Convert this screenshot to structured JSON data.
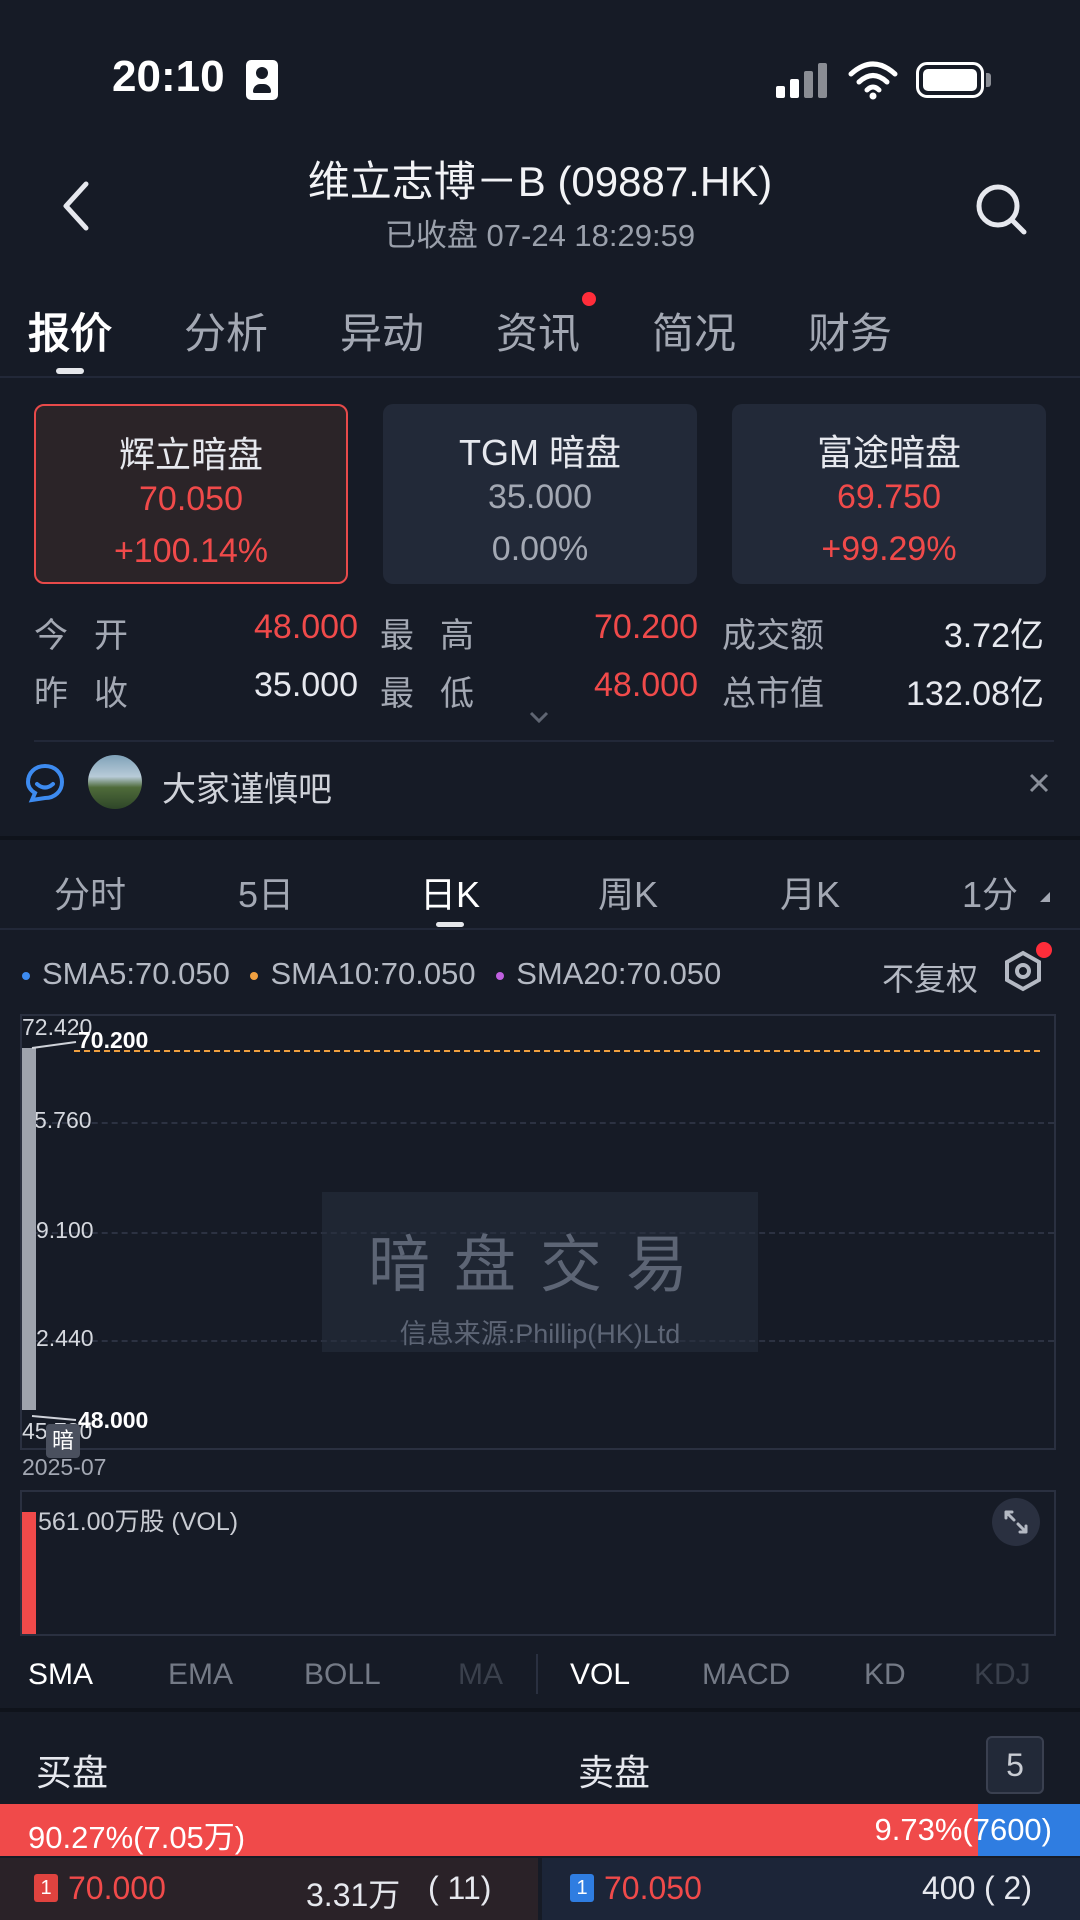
{
  "status_bar": {
    "time": "20:10",
    "icons": [
      "id-card-icon",
      "signal-icon",
      "wifi-icon",
      "battery-icon"
    ]
  },
  "header": {
    "title": "维立志博－B  (09887.HK)",
    "subtitle": "已收盘 07-24 18:29:59",
    "icons": [
      "back-arrow-icon",
      "search-icon"
    ]
  },
  "tabs": [
    {
      "label": "报价",
      "active": true
    },
    {
      "label": "分析"
    },
    {
      "label": "异动"
    },
    {
      "label": "资讯",
      "has_dot": true
    },
    {
      "label": "简况"
    },
    {
      "label": "财务"
    }
  ],
  "dark_pools": [
    {
      "name": "辉立暗盘",
      "price": "70.050",
      "change": "+100.14%",
      "selected": true,
      "color": "#f04a4a"
    },
    {
      "name": "TGM 暗盘",
      "price": "35.000",
      "change": "0.00%",
      "color": "#a3a8b3"
    },
    {
      "name": "富途暗盘",
      "price": "69.750",
      "change": "+99.29%",
      "color": "#f04a4a"
    }
  ],
  "quote": {
    "open_label": "今开",
    "open": "48.000",
    "high_label": "最高",
    "high": "70.200",
    "turnover_label": "成交额",
    "turnover": "3.72亿",
    "prev_close_label": "昨收",
    "prev_close": "35.000",
    "low_label": "最低",
    "low": "48.000",
    "market_cap_label": "总市值",
    "market_cap": "132.08亿"
  },
  "community": {
    "message": "大家谨慎吧",
    "icons": [
      "chat-bubble-icon",
      "close-icon"
    ]
  },
  "chart_tabs": [
    {
      "label": "分时"
    },
    {
      "label": "5日"
    },
    {
      "label": "日K",
      "active": true
    },
    {
      "label": "周K"
    },
    {
      "label": "月K"
    },
    {
      "label": "1分"
    }
  ],
  "ma_legend": {
    "sma5": "SMA5:70.050",
    "sma10": "SMA10:70.050",
    "sma20": "SMA20:70.050",
    "colors": {
      "sma5": "#3d8bf0",
      "sma10": "#f0a040",
      "sma20": "#c060e0"
    }
  },
  "adjust_label": "不复权",
  "chart_data": {
    "type": "candlestick",
    "y_ticks": [
      "72.420",
      "5.760",
      "9.100",
      "2.440",
      "45.780"
    ],
    "x_label": "2025-07",
    "high_marker": "70.200",
    "low_marker": "48.000",
    "dark_tag": "暗",
    "candles": [
      {
        "open": 48.0,
        "high": 70.2,
        "low": 48.0,
        "close": 70.05
      }
    ]
  },
  "watermark": {
    "title": "暗盘交易",
    "subtitle": "信息来源:Phillip(HK)Ltd"
  },
  "volume": {
    "label": "561.00万股 (VOL)"
  },
  "indicators": [
    {
      "label": "SMA",
      "active": true
    },
    {
      "label": "EMA"
    },
    {
      "label": "BOLL"
    },
    {
      "label": "MA"
    },
    {
      "label": "VOL",
      "active": true
    },
    {
      "label": "MACD"
    },
    {
      "label": "KD"
    },
    {
      "label": "KDJ"
    }
  ],
  "order_book": {
    "buy_label": "买盘",
    "sell_label": "卖盘",
    "depth": "5",
    "buy_ratio_text": "90.27%(7.05万)",
    "sell_ratio_text": "9.73%(7600)",
    "buy_ratio": 90.27,
    "bid": {
      "level": "1",
      "price": "70.000",
      "volume": "3.31万",
      "orders": "(  11)"
    },
    "ask": {
      "level": "1",
      "price": "70.050",
      "volume": "400",
      "orders": "(   2)"
    }
  }
}
